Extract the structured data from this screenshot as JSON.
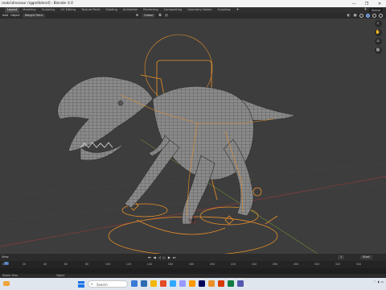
{
  "window": {
    "title": "rooks\\dinosaur rigged\\blend] - Blender 4.0",
    "controls": [
      "—",
      "❐",
      "✕"
    ]
  },
  "workspace_tabs": [
    {
      "label": "Layout",
      "active": true
    },
    {
      "label": "Modeling",
      "active": false
    },
    {
      "label": "Sculpting",
      "active": false
    },
    {
      "label": "UV Editing",
      "active": false
    },
    {
      "label": "Texture Paint",
      "active": false
    },
    {
      "label": "Shading",
      "active": false
    },
    {
      "label": "Animation",
      "active": false
    },
    {
      "label": "Rendering",
      "active": false
    },
    {
      "label": "Compositing",
      "active": false
    },
    {
      "label": "Geometry Nodes",
      "active": false
    },
    {
      "label": "Scripting",
      "active": false
    }
  ],
  "tab_add": "+",
  "scene": {
    "label": "Scene"
  },
  "viewport_header": {
    "add": "Add",
    "object": "Object",
    "mode": "Weight Paint",
    "transform": "Global"
  },
  "timeline": {
    "label": "View",
    "start_label": "Start",
    "start_value": "1",
    "current_frame": "1",
    "playhead": "1",
    "ticks": [
      "0",
      "20",
      "40",
      "60",
      "80",
      "100",
      "120",
      "140",
      "160",
      "180",
      "200",
      "220",
      "240",
      "260",
      "280",
      "300",
      "320",
      "340"
    ],
    "controls": [
      "⏮",
      "◀",
      "◁",
      "▷",
      "▶",
      "⏭"
    ]
  },
  "statusbar": {
    "left": "Rotate View",
    "mid": "Object"
  },
  "taskbar": {
    "search_placeholder": "Search"
  },
  "colors": {
    "viewport_bg": "#3d3d3d",
    "rig": "#e8902a",
    "mesh": "#b8b8b8",
    "accent": "#4772b3"
  }
}
